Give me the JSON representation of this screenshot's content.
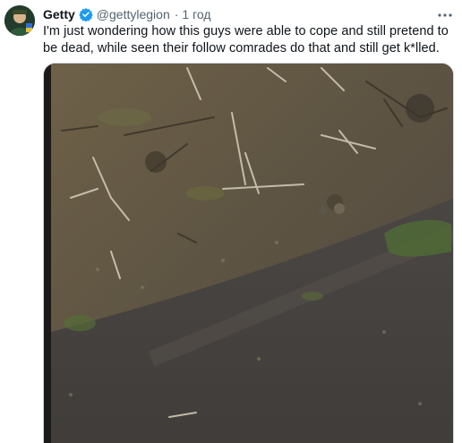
{
  "tweet": {
    "display_name": "Getty",
    "handle": "@gettylegion",
    "separator": "·",
    "timestamp": "1 год",
    "text": "I'm just wondering how this guys were able to cope and still pretend to be dead, while seen their follow comrades do that and still get k*lled.",
    "icons": {
      "verified": "verified-badge-icon",
      "more": "more-options-icon"
    },
    "colors": {
      "verified": "#1d9bf0",
      "secondary_text": "#536471"
    }
  },
  "media": {
    "type": "video",
    "description_icon": "video-thumbnail"
  }
}
